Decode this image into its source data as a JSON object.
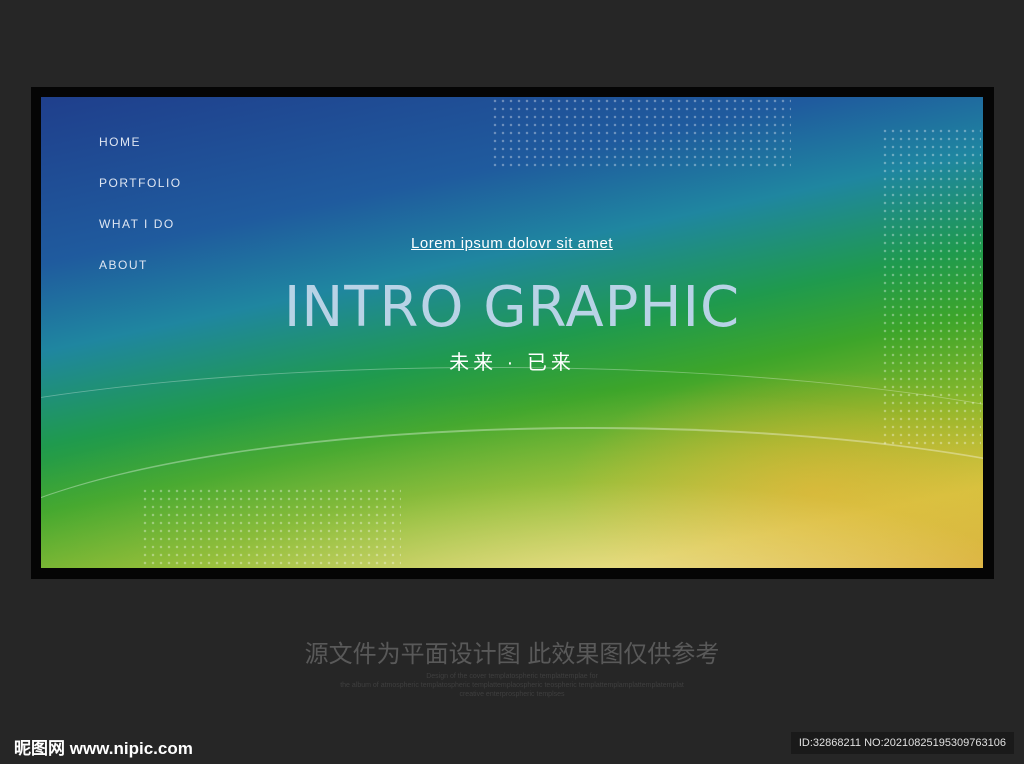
{
  "nav": [
    "HOME",
    "PORTFOLIO",
    "WHAT I DO",
    "ABOUT"
  ],
  "subtitle": "Lorem ipsum dolovr sit amet",
  "title": "INTRO GRAPHIC",
  "chinese_tagline": "未来 · 已来",
  "caption": "源文件为平面设计图 此效果图仅供参考",
  "small_text": [
    "Design of the cover templatospheric templattemplae for",
    "the album of atmospheric templatospheric templattemplaospheric teospheric templattemplamplattemplatemplat",
    "creative enterprospheric templses"
  ],
  "watermark": {
    "logo": "昵图网 www.nipic.com",
    "id": "ID:32868211 NO:20210825195309763106"
  }
}
